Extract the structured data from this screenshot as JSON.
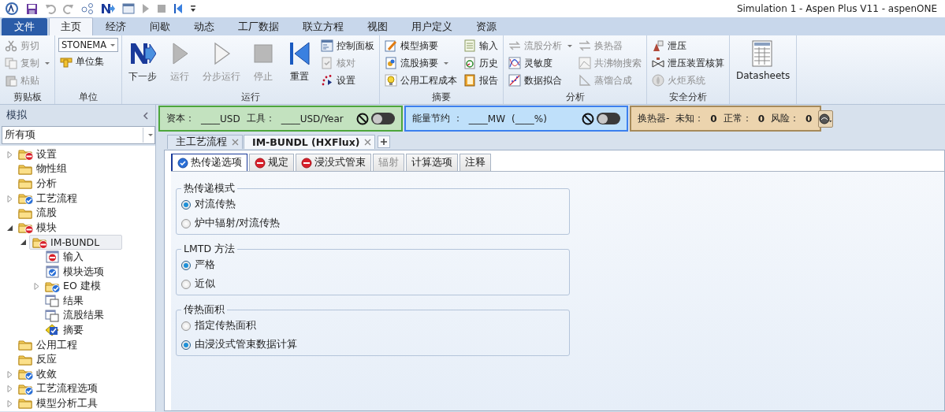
{
  "window": {
    "title": "Simulation 1 - Aspen Plus V11 - aspenONE"
  },
  "ribbon_tabs": [
    {
      "label": "文件",
      "kind": "file",
      "selected": false
    },
    {
      "label": "主页",
      "kind": "tab",
      "selected": true
    },
    {
      "label": "经济",
      "kind": "tab",
      "selected": false
    },
    {
      "label": "间歇",
      "kind": "tab",
      "selected": false
    },
    {
      "label": "动态",
      "kind": "tab",
      "selected": false
    },
    {
      "label": "工厂数据",
      "kind": "tab",
      "selected": false
    },
    {
      "label": "联立方程",
      "kind": "tab",
      "selected": false
    },
    {
      "label": "视图",
      "kind": "tab",
      "selected": false
    },
    {
      "label": "用户定义",
      "kind": "tab",
      "selected": false
    },
    {
      "label": "资源",
      "kind": "tab",
      "selected": false
    }
  ],
  "ribbon_groups": [
    {
      "label": "剪贴板",
      "columns": [
        [
          {
            "kind": "small",
            "label": "剪切",
            "disabled": true
          },
          {
            "kind": "small",
            "label": "复制",
            "disabled": true,
            "dropdown": true
          },
          {
            "kind": "small",
            "label": "粘贴",
            "disabled": true
          }
        ]
      ]
    },
    {
      "label": "单位",
      "columns": [
        [
          {
            "kind": "combo",
            "value": "STONEMA"
          },
          {
            "kind": "small",
            "label": "单位集",
            "disabled": false
          }
        ]
      ]
    },
    {
      "label": "运行",
      "columns": [
        [
          {
            "kind": "large",
            "label": "下一步",
            "disabled": false
          }
        ],
        [
          {
            "kind": "large",
            "label": "运行",
            "disabled": true
          }
        ],
        [
          {
            "kind": "large",
            "label": "分步运行",
            "disabled": true
          }
        ],
        [
          {
            "kind": "large",
            "label": "停止",
            "disabled": true
          }
        ],
        [
          {
            "kind": "large",
            "label": "重置",
            "disabled": false
          }
        ],
        [
          {
            "kind": "small",
            "label": "控制面板",
            "disabled": false
          },
          {
            "kind": "small",
            "label": "核对",
            "disabled": true
          },
          {
            "kind": "small",
            "label": "设置",
            "disabled": false
          }
        ]
      ]
    },
    {
      "label": "摘要",
      "columns": [
        [
          {
            "kind": "small",
            "label": "模型摘要",
            "disabled": false
          },
          {
            "kind": "small",
            "label": "流股摘要",
            "disabled": false,
            "dropdown": true
          },
          {
            "kind": "small",
            "label": "公用工程成本",
            "disabled": false
          }
        ],
        [
          {
            "kind": "small",
            "label": "输入",
            "disabled": false
          },
          {
            "kind": "small",
            "label": "历史",
            "disabled": false
          },
          {
            "kind": "small",
            "label": "报告",
            "disabled": false
          }
        ]
      ]
    },
    {
      "label": "分析",
      "columns": [
        [
          {
            "kind": "small",
            "label": "流股分析",
            "disabled": true,
            "dropdown": true
          },
          {
            "kind": "small",
            "label": "灵敏度",
            "disabled": false
          },
          {
            "kind": "small",
            "label": "数据拟合",
            "disabled": false
          }
        ],
        [
          {
            "kind": "small",
            "label": "换热器",
            "disabled": true
          },
          {
            "kind": "small",
            "label": "共沸物搜索",
            "disabled": true
          },
          {
            "kind": "small",
            "label": "蒸馏合成",
            "disabled": true
          }
        ]
      ]
    },
    {
      "label": "安全分析",
      "columns": [
        [
          {
            "kind": "small",
            "label": "泄压",
            "disabled": false
          },
          {
            "kind": "small",
            "label": "泄压装置核算",
            "disabled": false
          },
          {
            "kind": "small",
            "label": "火炬系统",
            "disabled": true
          }
        ]
      ]
    },
    {
      "columns": [
        [
          {
            "kind": "large",
            "label": "Datasheets",
            "disabled": false
          }
        ]
      ]
    }
  ],
  "sidebar": {
    "title": "模拟",
    "filter": "所有项",
    "tree": [
      {
        "label": "设置",
        "kind": "folder",
        "valid": false,
        "expanded": false,
        "selected": false
      },
      {
        "label": "物性组",
        "kind": "folder",
        "selected": false
      },
      {
        "label": "分析",
        "kind": "folder",
        "selected": false
      },
      {
        "label": "工艺流程",
        "kind": "folder",
        "valid": true,
        "expanded": false,
        "selected": false
      },
      {
        "label": "流股",
        "kind": "folder",
        "selected": false
      },
      {
        "label": "模块",
        "kind": "folder",
        "valid": false,
        "expanded": true,
        "selected": false,
        "children": [
          {
            "label": "IM-BUNDL",
            "kind": "folder",
            "valid": false,
            "expanded": true,
            "selected": true,
            "children": [
              {
                "label": "输入",
                "kind": "form",
                "valid": false,
                "selected": false
              },
              {
                "label": "模块选项",
                "kind": "form",
                "valid": true,
                "selected": false
              },
              {
                "label": "EO 建模",
                "kind": "folder",
                "valid": true,
                "expanded": false,
                "selected": false
              },
              {
                "label": "结果",
                "kind": "results",
                "selected": false
              },
              {
                "label": "流股结果",
                "kind": "results",
                "selected": false
              },
              {
                "label": "摘要",
                "kind": "summary",
                "selected": false
              }
            ]
          }
        ]
      },
      {
        "label": "公用工程",
        "kind": "folder",
        "selected": false
      },
      {
        "label": "反应",
        "kind": "folder",
        "selected": false
      },
      {
        "label": "收敛",
        "kind": "folder",
        "valid": true,
        "expanded": false,
        "selected": false
      },
      {
        "label": "工艺流程选项",
        "kind": "folder",
        "valid": true,
        "expanded": false,
        "selected": false
      },
      {
        "label": "模型分析工具",
        "kind": "folder",
        "expanded": false,
        "selected": false
      }
    ]
  },
  "panels": [
    {
      "kind": "cost",
      "segments": [
        {
          "text": "资本："
        },
        {
          "text": "____USD"
        },
        {
          "text": "工具："
        },
        {
          "text": "____USD/Year"
        }
      ],
      "toggle": {
        "on": false
      }
    },
    {
      "kind": "energy",
      "segments": [
        {
          "text": "能量节约 ："
        },
        {
          "text": "____MW"
        },
        {
          "text": "(____%)"
        }
      ],
      "toggle": {
        "on": false
      }
    },
    {
      "kind": "exchanger",
      "segments": [
        {
          "text": "换热器-"
        },
        {
          "text": "未知："
        },
        {
          "text": "0",
          "bold": true
        },
        {
          "text": "正常："
        },
        {
          "text": "0",
          "bold": true
        },
        {
          "text": "风险："
        },
        {
          "text": "0",
          "bold": true
        }
      ]
    }
  ],
  "document_tabs": [
    {
      "label": "主工艺流程",
      "selected": false
    },
    {
      "label": "IM-BUNDL (HXFlux)",
      "selected": true
    }
  ],
  "form_tabs": [
    {
      "label": "热传递选项",
      "valid": true,
      "selected": true,
      "disabled": false
    },
    {
      "label": "规定",
      "valid": false,
      "selected": false,
      "disabled": false
    },
    {
      "label": "浸没式管束",
      "valid": false,
      "selected": false,
      "disabled": false
    },
    {
      "label": "辐射",
      "selected": false,
      "disabled": true
    },
    {
      "label": "计算选项",
      "selected": false,
      "disabled": false
    },
    {
      "label": "注释",
      "selected": false,
      "disabled": false
    }
  ],
  "option_groups": [
    {
      "title": "热传递模式",
      "options": [
        {
          "label": "对流传热",
          "checked": true
        },
        {
          "label": "炉中辐射/对流传热",
          "checked": false
        }
      ]
    },
    {
      "title": "LMTD 方法",
      "options": [
        {
          "label": "严格",
          "checked": true
        },
        {
          "label": "近似",
          "checked": false
        }
      ]
    },
    {
      "title": "传热面积",
      "options": [
        {
          "label": "指定传热面积",
          "checked": false
        },
        {
          "label": "由浸没式管束数据计算",
          "checked": true
        }
      ]
    }
  ]
}
